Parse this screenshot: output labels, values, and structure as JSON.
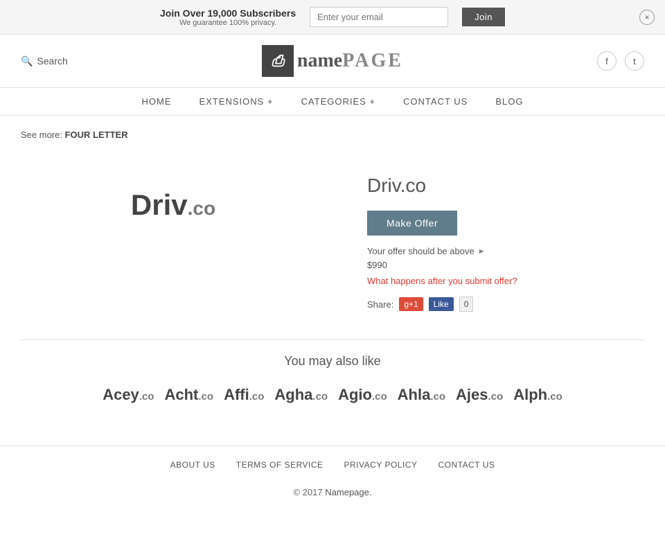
{
  "banner": {
    "main_text": "Join Over 19,000 Subscribers",
    "sub_text": "We guarantee 100% privacy.",
    "email_placeholder": "Enter your email",
    "join_label": "Join",
    "close_label": "×"
  },
  "header": {
    "search_label": "Search",
    "logo_icon": "n",
    "logo_name": "name",
    "logo_page": "PAGE",
    "facebook_label": "f",
    "twitter_label": "t"
  },
  "nav": {
    "items": [
      {
        "label": "HOME"
      },
      {
        "label": "EXTENSIONS +"
      },
      {
        "label": "CATEGORIES +"
      },
      {
        "label": "CONTACT US"
      },
      {
        "label": "BLOG"
      }
    ]
  },
  "breadcrumb": {
    "see_more_label": "See more:",
    "link_label": "FOUR LETTER"
  },
  "domain": {
    "logo_name": "Driv",
    "logo_tld": ".co",
    "title": "Driv.co",
    "make_offer_label": "Make Offer",
    "offer_info": "Your offer should be above",
    "offer_price": "$990",
    "offer_question": "What happens after you submit offer?",
    "share_label": "Share:",
    "gplus_label": "g+1",
    "fb_like_label": "Like",
    "fb_count": "0"
  },
  "also_like": {
    "title": "You may also like",
    "domains": [
      {
        "name": "Acey",
        "tld": ".co"
      },
      {
        "name": "Acht",
        "tld": ".co"
      },
      {
        "name": "Affi",
        "tld": ".co"
      },
      {
        "name": "Agha",
        "tld": ".co"
      },
      {
        "name": "Agio",
        "tld": ".co"
      },
      {
        "name": "Ahla",
        "tld": ".co"
      },
      {
        "name": "Ajes",
        "tld": ".co"
      },
      {
        "name": "Alph",
        "tld": ".co"
      }
    ]
  },
  "footer": {
    "links": [
      {
        "label": "ABOUT US"
      },
      {
        "label": "TERMS OF SERVICE"
      },
      {
        "label": "PRIVACY POLICY"
      },
      {
        "label": "CONTACT US"
      }
    ],
    "copy": "© 2017",
    "copy_link": "Namepage."
  }
}
